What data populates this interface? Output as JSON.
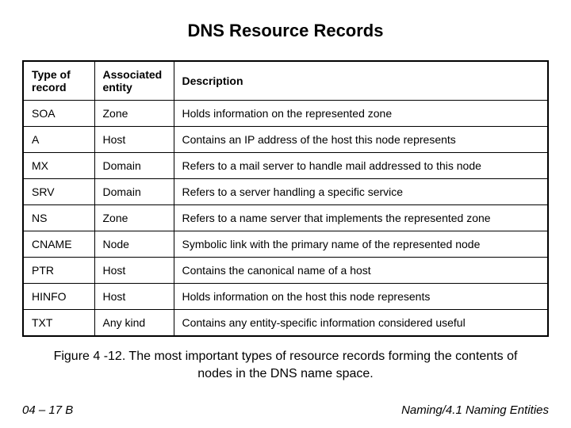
{
  "title": "DNS Resource Records",
  "headers": {
    "type": "Type of record",
    "entity": "Associated entity",
    "description": "Description"
  },
  "rows": [
    {
      "type": "SOA",
      "entity": "Zone",
      "description": "Holds information on the represented zone"
    },
    {
      "type": "A",
      "entity": "Host",
      "description": "Contains an IP address of the host this node represents"
    },
    {
      "type": "MX",
      "entity": "Domain",
      "description": "Refers to a mail server to handle mail addressed to this node"
    },
    {
      "type": "SRV",
      "entity": "Domain",
      "description": "Refers to a server handling a specific service"
    },
    {
      "type": "NS",
      "entity": "Zone",
      "description": "Refers to a name server that implements the represented zone"
    },
    {
      "type": "CNAME",
      "entity": "Node",
      "description": "Symbolic link with the primary name of the represented node"
    },
    {
      "type": "PTR",
      "entity": "Host",
      "description": "Contains the canonical name of a host"
    },
    {
      "type": "HINFO",
      "entity": "Host",
      "description": "Holds information on the host this node represents"
    },
    {
      "type": "TXT",
      "entity": "Any kind",
      "description": "Contains any entity-specific information considered useful"
    }
  ],
  "caption": "Figure 4 -12. The most important types of resource records forming the contents of nodes in the DNS name space.",
  "footer": {
    "left": "04 – 17 B",
    "right": "Naming/4.1 Naming Entities"
  },
  "chart_data": {
    "type": "table",
    "columns": [
      "Type of record",
      "Associated entity",
      "Description"
    ],
    "rows": [
      [
        "SOA",
        "Zone",
        "Holds information on the represented zone"
      ],
      [
        "A",
        "Host",
        "Contains an IP address of the host this node represents"
      ],
      [
        "MX",
        "Domain",
        "Refers to a mail server to handle mail addressed to this node"
      ],
      [
        "SRV",
        "Domain",
        "Refers to a server handling a specific service"
      ],
      [
        "NS",
        "Zone",
        "Refers to a name server that implements the represented zone"
      ],
      [
        "CNAME",
        "Node",
        "Symbolic link with the primary name of the represented node"
      ],
      [
        "PTR",
        "Host",
        "Contains the canonical name of a host"
      ],
      [
        "HINFO",
        "Host",
        "Holds information on the host this node represents"
      ],
      [
        "TXT",
        "Any kind",
        "Contains any entity-specific information considered useful"
      ]
    ]
  }
}
